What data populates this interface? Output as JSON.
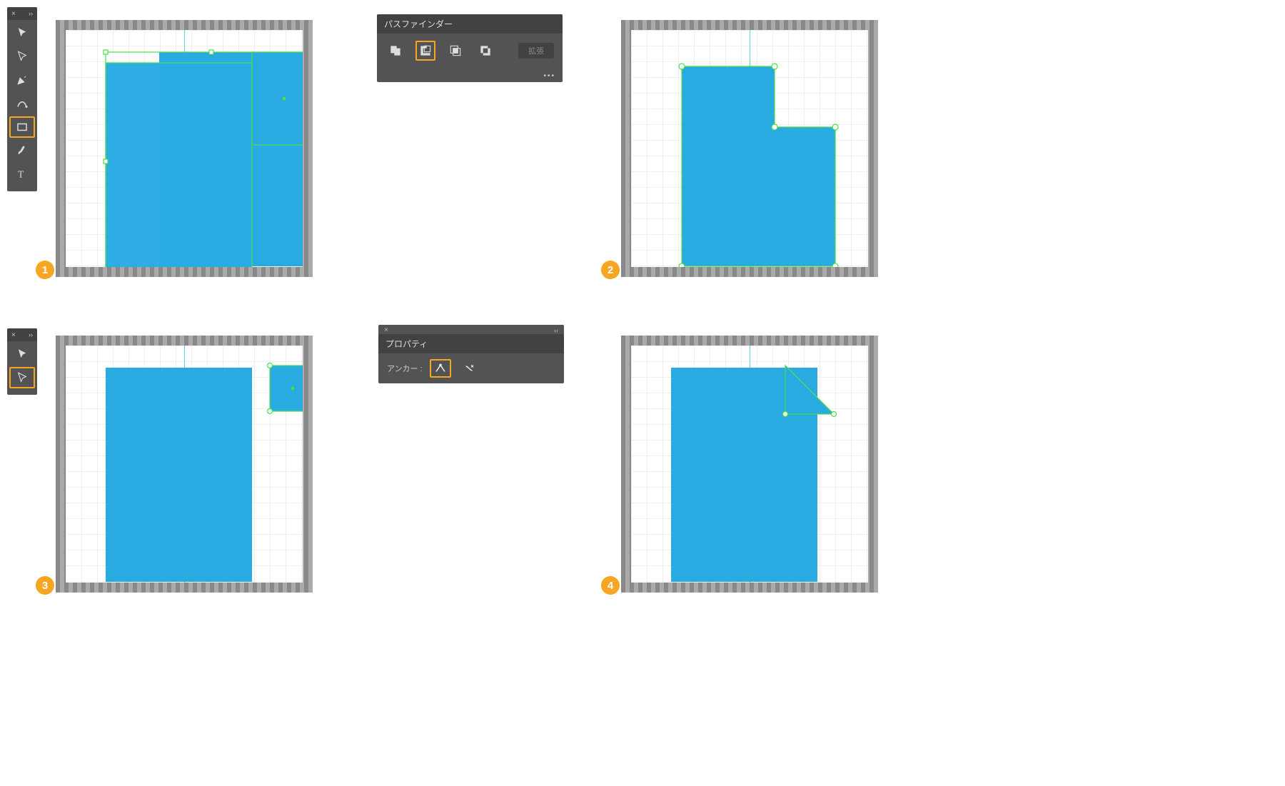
{
  "steps": {
    "s1": "1",
    "s2": "2",
    "s3": "3",
    "s4": "4"
  },
  "pathfinder": {
    "title": "パスファインダー",
    "expand_label": "拡張"
  },
  "properties": {
    "title": "プロパティ",
    "anchor_label": "アンカー :"
  },
  "colors": {
    "shape": "#29abe2",
    "selection": "#4ade4a",
    "highlight": "#f5a623",
    "panel_bg": "#535353"
  }
}
